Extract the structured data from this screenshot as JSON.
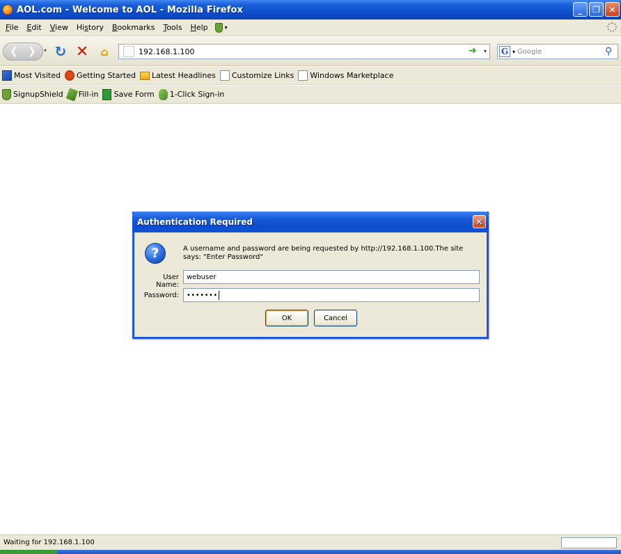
{
  "window": {
    "title": "AOL.com - Welcome to AOL - Mozilla Firefox",
    "controls": [
      "minimize",
      "maximize",
      "close"
    ]
  },
  "menu": {
    "items": [
      {
        "label": "File",
        "acc": "F"
      },
      {
        "label": "Edit",
        "acc": "E"
      },
      {
        "label": "View",
        "acc": "V"
      },
      {
        "label": "History",
        "acc": "s"
      },
      {
        "label": "Bookmarks",
        "acc": "B"
      },
      {
        "label": "Tools",
        "acc": "T"
      },
      {
        "label": "Help",
        "acc": "H"
      }
    ]
  },
  "nav": {
    "url": "192.168.1.100",
    "search_placeholder": "Google",
    "search_engine_letter": "G"
  },
  "bookmarks": {
    "items": [
      {
        "label": "Most Visited",
        "icon": "most-visited-icon"
      },
      {
        "label": "Getting Started",
        "icon": "getting-started-icon"
      },
      {
        "label": "Latest Headlines",
        "icon": "folder-icon"
      },
      {
        "label": "Customize Links",
        "icon": "page-icon"
      },
      {
        "label": "Windows Marketplace",
        "icon": "page-icon"
      }
    ]
  },
  "toolbar2": {
    "items": [
      {
        "label": "SignupShield",
        "icon": "shield-icon"
      },
      {
        "label": "Fill-in",
        "icon": "fill-in-icon"
      },
      {
        "label": "Save Form",
        "icon": "save-form-icon"
      },
      {
        "label": "1-Click Sign-in",
        "icon": "sign-in-icon"
      }
    ]
  },
  "dialog": {
    "title": "Authentication Required",
    "message": "A username and password are being requested by http://192.168.1.100.The site says: \"Enter Password\"",
    "user_label": "User Name:",
    "user_value": "webuser",
    "password_label": "Password:",
    "password_mask": "•••••••",
    "ok_label": "OK",
    "cancel_label": "Cancel"
  },
  "status": {
    "text": "Waiting for 192.168.1.100"
  }
}
